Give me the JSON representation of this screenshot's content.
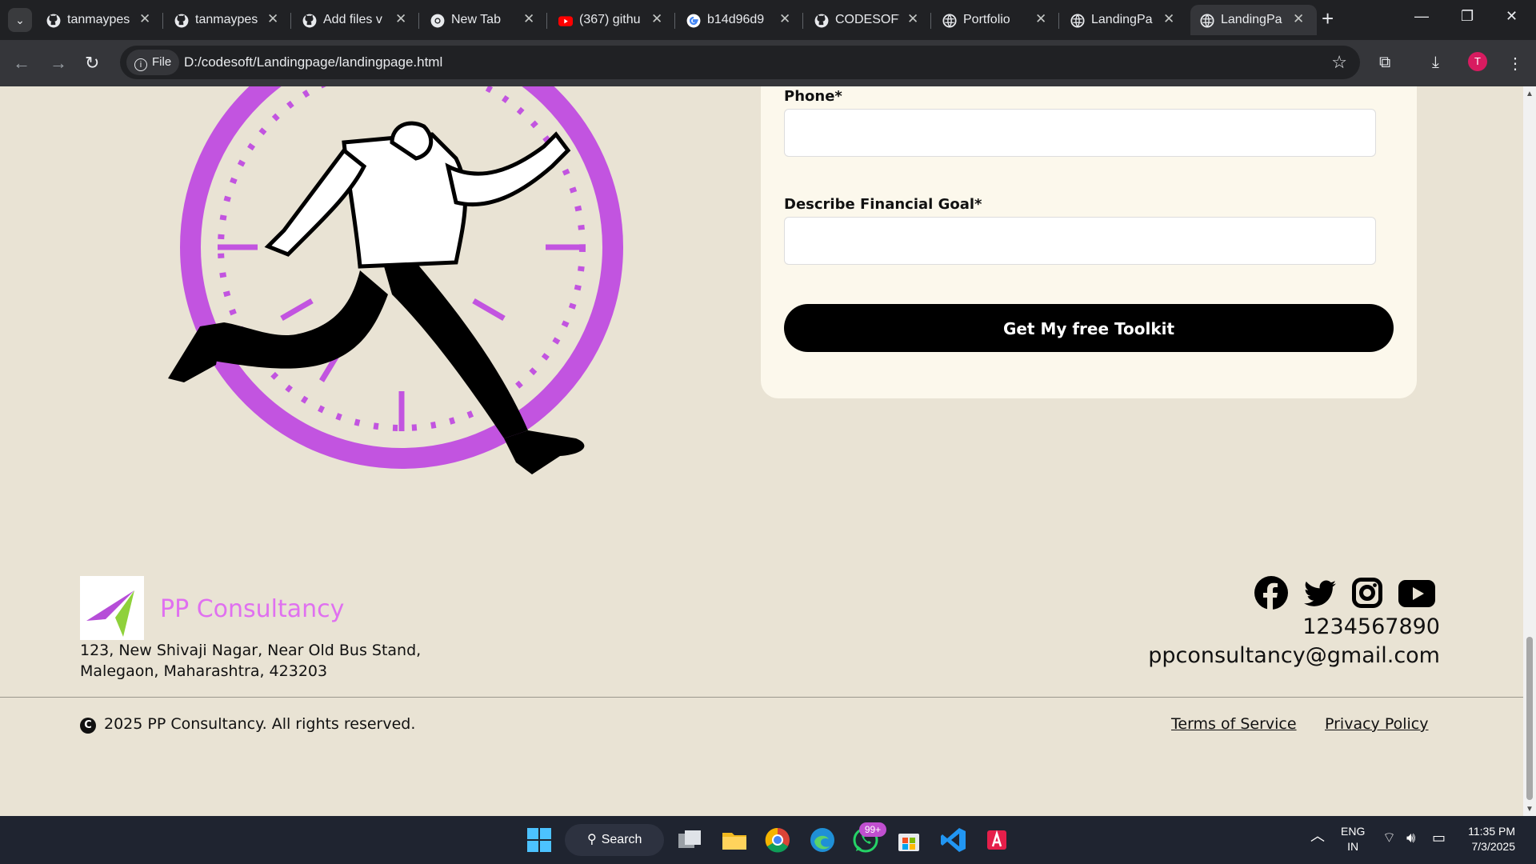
{
  "browser": {
    "tabs": [
      {
        "title": "tanmaypes",
        "favicon": "github-icon"
      },
      {
        "title": "tanmaypes",
        "favicon": "github-icon"
      },
      {
        "title": "Add files v",
        "favicon": "github-icon"
      },
      {
        "title": "New Tab",
        "favicon": "chrome-icon"
      },
      {
        "title": "(367) githu",
        "favicon": "youtube-icon"
      },
      {
        "title": "b14d96d9",
        "favicon": "google-icon"
      },
      {
        "title": "CODESOFT",
        "favicon": "github-icon"
      },
      {
        "title": "Portfolio",
        "favicon": "globe-icon"
      },
      {
        "title": "LandingPa",
        "favicon": "globe-icon"
      },
      {
        "title": "LandingPa",
        "favicon": "globe-icon",
        "active": true
      }
    ],
    "chip_label": "File",
    "url": "D:/codesoft/Landingpage/landingpage.html",
    "profile_initial": "T"
  },
  "form": {
    "phone_label": "Phone*",
    "phone_value": "",
    "goal_label": "Describe Financial Goal*",
    "goal_value": "",
    "submit_label": "Get My free Toolkit"
  },
  "footer": {
    "brand": "PP Consultancy",
    "address_line1": "123, New Shivaji Nagar, Near Old Bus Stand,",
    "address_line2": "Malegaon, Maharashtra, 423203",
    "phone": "1234567890",
    "email": "ppconsultancy@gmail.com",
    "socials": [
      "facebook-icon",
      "twitter-icon",
      "instagram-icon",
      "youtube-icon"
    ],
    "copyright_symbol": "C",
    "copyright": "2025 PP Consultancy. All rights reserved.",
    "terms": "Terms of Service",
    "privacy": "Privacy Policy"
  },
  "taskbar": {
    "search_label": "Search",
    "whatsapp_badge": "99+",
    "language": "ENG",
    "region": "IN",
    "time": "11:35 PM",
    "date": "7/3/2025"
  },
  "colors": {
    "page_bg": "#e9e3d4",
    "card_bg": "#fcf8ec",
    "accent_purple": "#c254e0",
    "brand_pink": "#e070f0",
    "button_bg": "#000000"
  }
}
